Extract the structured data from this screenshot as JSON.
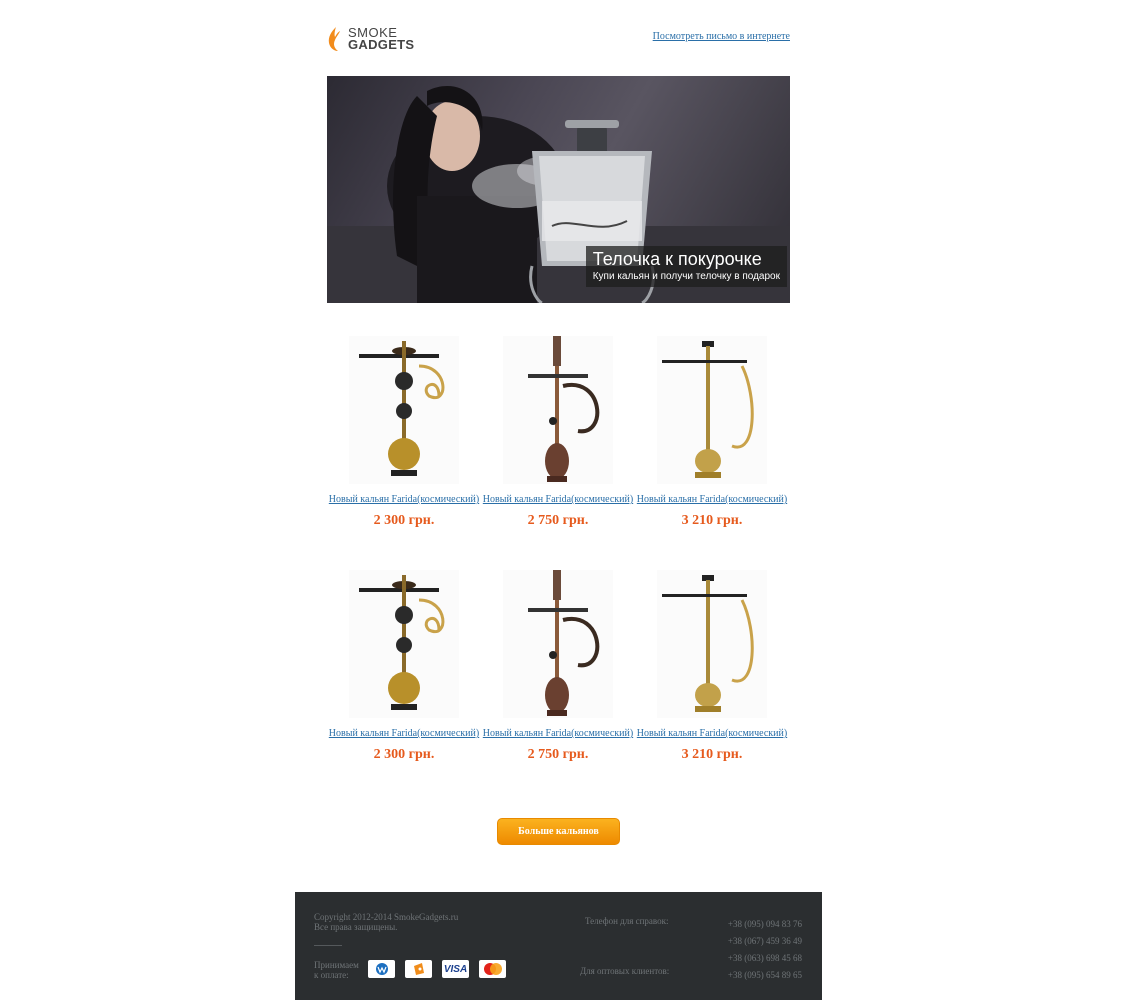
{
  "header": {
    "logo_line1": "SMOKE",
    "logo_line2": "GADGETS",
    "view_online_link": "Посмотреть письмо в интернете"
  },
  "banner": {
    "title": "Телочка к покурочке",
    "subtitle": "Купи кальян и получи телочку в подарок"
  },
  "products": [
    {
      "name": "Новый кальян Farida(космический)",
      "price": "2 300 грн."
    },
    {
      "name": "Новый кальян Farida(космический)",
      "price": "2 750 грн."
    },
    {
      "name": "Новый кальян Farida(космический)",
      "price": "3 210 грн."
    },
    {
      "name": "Новый кальян Farida(космический)",
      "price": "2 300 грн."
    },
    {
      "name": "Новый кальян Farida(космический)",
      "price": "2 750 грн."
    },
    {
      "name": "Новый кальян Farida(космический)",
      "price": "3 210 грн."
    }
  ],
  "more_button": "Больше кальянов",
  "footer": {
    "copyright_line1": "Copyright 2012-2014 SmokeGadgets.ru",
    "copyright_line2": "Все права защищены.",
    "accept_line1": "Принимаем",
    "accept_line2": "к оплате:",
    "phone_label": "Телефон для справок:",
    "wholesale_label": "Для оптовых клиентов:",
    "phones": [
      "+38 (095) 094 83 76",
      "+38 (067) 459 36 49",
      "+38 (063) 698 45 68",
      "+38 (095) 654 89 65"
    ],
    "payment_icons": [
      "webmoney-icon",
      "yandex-money-icon",
      "visa-icon",
      "mastercard-icon"
    ],
    "visa_text": "VISA"
  },
  "colors": {
    "accent_orange": "#e65a1d",
    "button_orange": "#f39a0d",
    "link_blue": "#2a6fa8",
    "footer_bg": "#2b2e30"
  }
}
